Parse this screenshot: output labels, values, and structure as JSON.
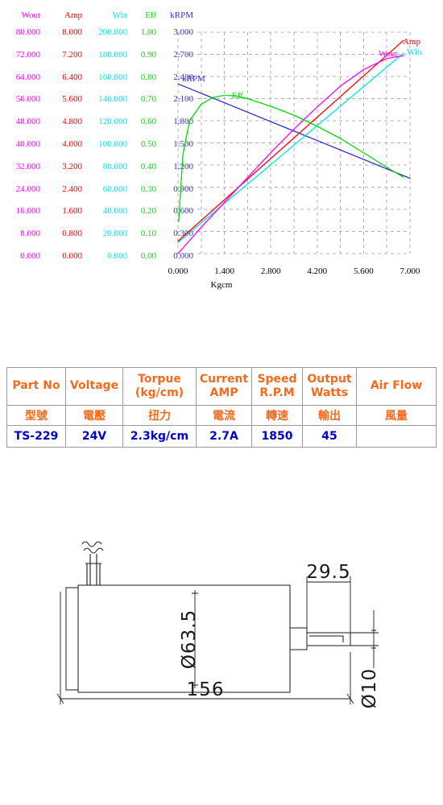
{
  "chart_data": {
    "type": "line",
    "title": "",
    "xlabel": "Kgcm",
    "xlim": [
      0,
      7
    ],
    "xticks": [
      "0.000",
      "1.400",
      "2.800",
      "4.200",
      "5.600",
      "7.000"
    ],
    "grid": true,
    "gridcols": 10,
    "gridrows": 10,
    "axes": [
      {
        "name": "Wout",
        "color": "#FF00FF",
        "ylim": [
          0,
          80
        ],
        "ticks": [
          "0.000",
          "8.000",
          "16.000",
          "24.000",
          "32.000",
          "40.000",
          "48.000",
          "56.000",
          "64.000",
          "72.000",
          "80.000"
        ]
      },
      {
        "name": "Amp",
        "color": "#FF0000",
        "ylim": [
          0,
          8
        ],
        "ticks": [
          "0.000",
          "0.800",
          "1.600",
          "2.400",
          "3.200",
          "4.000",
          "4.800",
          "5.600",
          "6.400",
          "7.200",
          "8.000"
        ]
      },
      {
        "name": "Win",
        "color": "#00E5EE",
        "ylim": [
          0,
          200
        ],
        "ticks": [
          "0.000",
          "20.000",
          "40.000",
          "60.000",
          "80.000",
          "100.000",
          "120.000",
          "140.000",
          "160.000",
          "180.000",
          "200.000"
        ]
      },
      {
        "name": "Eff",
        "color": "#00DD00",
        "ylim": [
          0,
          1
        ],
        "ticks": [
          "0.00",
          "0.10",
          "0.20",
          "0.30",
          "0.40",
          "0.50",
          "0.60",
          "0.70",
          "0.80",
          "0.90",
          "1.00"
        ]
      },
      {
        "name": "kRPM",
        "color": "#3333CC",
        "ylim": [
          0,
          3
        ],
        "ticks": [
          "0.000",
          "0.300",
          "0.600",
          "0.900",
          "1.200",
          "1.500",
          "1.800",
          "2.100",
          "2.400",
          "2.700",
          "3.000"
        ]
      }
    ],
    "series": [
      {
        "name": "kRPM",
        "color": "#3333CC",
        "axis": "kRPM",
        "x": [
          0,
          7
        ],
        "values": [
          2.3,
          1.02
        ]
      },
      {
        "name": "Amp",
        "color": "#FF0000",
        "axis": "Amp",
        "x": [
          0,
          6.8
        ],
        "values": [
          0.45,
          7.7
        ]
      },
      {
        "name": "Win",
        "color": "#00E5EE",
        "axis": "Win",
        "x": [
          0,
          6.8
        ],
        "values": [
          10.0,
          181.0
        ]
      },
      {
        "name": "Wout",
        "color": "#FF00FF",
        "axis": "Wout",
        "x": [
          0,
          0.7,
          1.4,
          2.1,
          2.8,
          3.5,
          4.2,
          4.9,
          5.6,
          6.3,
          6.8
        ],
        "values": [
          0.0,
          9.5,
          18.5,
          27.5,
          36.5,
          45.0,
          53.0,
          60.5,
          66.5,
          70.5,
          71.5
        ]
      },
      {
        "name": "Eff",
        "color": "#00DD00",
        "axis": "Eff",
        "x": [
          0.02,
          0.15,
          0.35,
          0.7,
          1.05,
          1.4,
          1.75,
          2.1,
          2.8,
          3.5,
          4.2,
          4.9,
          5.6,
          6.3,
          6.8
        ],
        "values": [
          0.145,
          0.45,
          0.6,
          0.675,
          0.705,
          0.715,
          0.712,
          0.7,
          0.665,
          0.625,
          0.575,
          0.52,
          0.455,
          0.39,
          0.345
        ]
      }
    ],
    "curve_labels": [
      {
        "text": "Amp",
        "color": "#FF0000"
      },
      {
        "text": "Win",
        "color": "#00E5EE"
      },
      {
        "text": "Wout",
        "color": "#FF00FF"
      },
      {
        "text": "kRPM",
        "color": "#3333CC"
      },
      {
        "text": "Eff",
        "color": "#00DD00"
      }
    ]
  },
  "spec": {
    "headers_en": [
      "Part No",
      "Voltage",
      "Torpue\n(kg/cm)",
      "Current\nAMP",
      "Speed\nR.P.M",
      "Output\nWatts",
      "Air  Flow"
    ],
    "h0_en": "Part No",
    "h1_en": "Voltage",
    "h2_en_a": "Torpue",
    "h2_en_b": "(kg/cm)",
    "h3_en_a": "Current",
    "h3_en_b": "AMP",
    "h4_en_a": "Speed",
    "h4_en_b": "R.P.M",
    "h5_en_a": "Output",
    "h5_en_b": "Watts",
    "h6_en": "Air  Flow",
    "h0_cn": "型號",
    "h1_cn": "電壓",
    "h2_cn": "扭力",
    "h3_cn": "電流",
    "h4_cn": "轉速",
    "h5_cn": "輸出",
    "h6_cn": "風量",
    "v0": "TS-229",
    "v1": "24V",
    "v2": "2.3kg/cm",
    "v3": "2.7A",
    "v4": "1850",
    "v5": "45",
    "v6": "",
    "header_color": "#F26B1F",
    "value_color": "#0000CC"
  },
  "drawing": {
    "dim_length": "156",
    "dim_diameter": "Ø63.5",
    "dim_shaft_length": "29.5",
    "dim_shaft_diameter": "Ø10"
  }
}
